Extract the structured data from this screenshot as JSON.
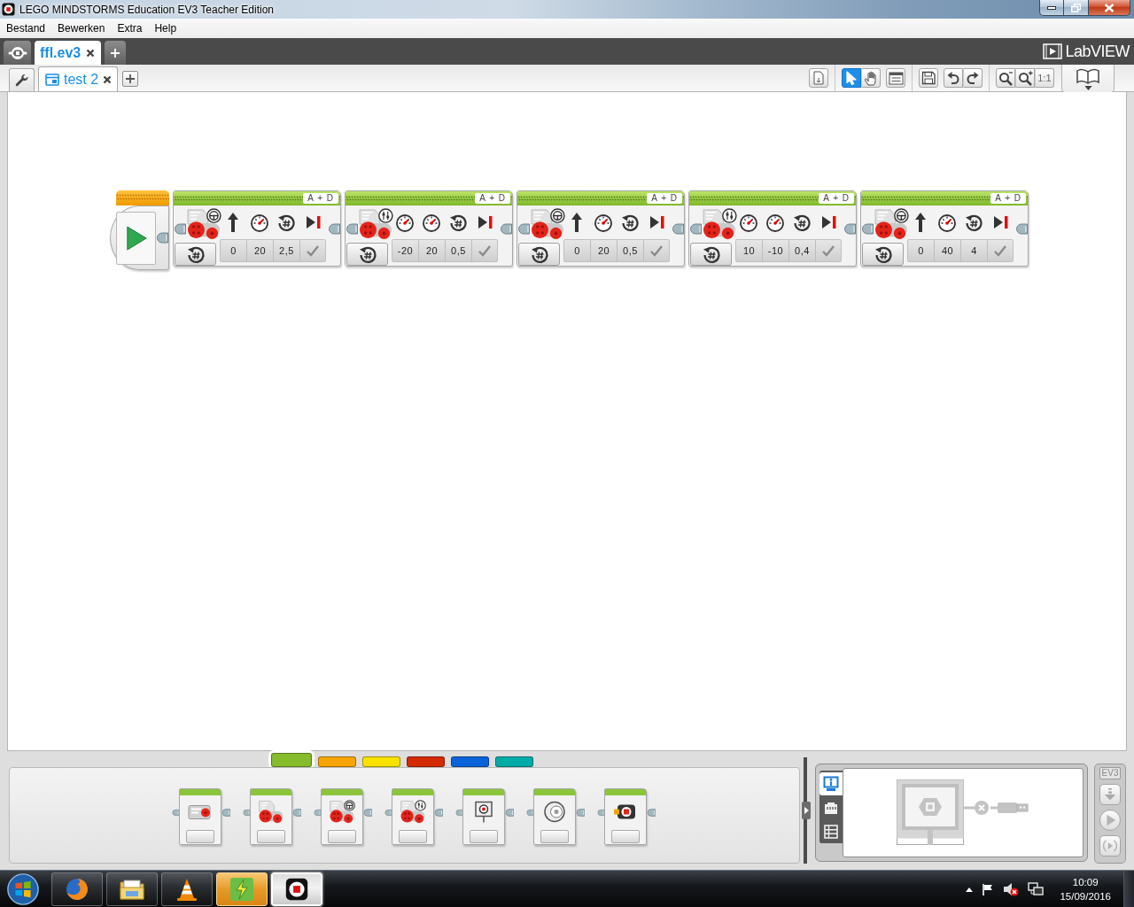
{
  "window": {
    "title": "LEGO MINDSTORMS Education EV3 Teacher Edition"
  },
  "menu": [
    {
      "label": "Bestand"
    },
    {
      "label": "Bewerken"
    },
    {
      "label": "Extra"
    },
    {
      "label": "Help"
    }
  ],
  "project_tabs": [
    {
      "label": "ffl.ev3",
      "selected": true
    }
  ],
  "brand": {
    "label": "LabVIEW"
  },
  "program_tabs": [
    {
      "label": "test 2",
      "selected": true
    }
  ],
  "toolbar": {
    "tools": [
      {
        "kind": "pointer",
        "selected": true
      },
      {
        "kind": "pan",
        "selected": false
      }
    ],
    "zoom_reset": "1:1"
  },
  "program": {
    "blocks": [
      {
        "kind": "start"
      },
      {
        "kind": "steering",
        "ports": "A + D",
        "brake": true,
        "inputs": [
          {
            "kind": "steering",
            "value": "0"
          },
          {
            "kind": "power",
            "value": "20"
          },
          {
            "kind": "rotations",
            "value": "2,5"
          }
        ]
      },
      {
        "kind": "tank",
        "ports": "A + D",
        "brake": true,
        "inputs": [
          {
            "kind": "power",
            "value": "-20"
          },
          {
            "kind": "power",
            "value": "20"
          },
          {
            "kind": "rotations",
            "value": "0,5"
          }
        ]
      },
      {
        "kind": "steering",
        "ports": "A + D",
        "brake": true,
        "inputs": [
          {
            "kind": "steering",
            "value": "0"
          },
          {
            "kind": "power",
            "value": "20"
          },
          {
            "kind": "rotations",
            "value": "0,5"
          }
        ]
      },
      {
        "kind": "tank",
        "ports": "A + D",
        "brake": true,
        "inputs": [
          {
            "kind": "power",
            "value": "10"
          },
          {
            "kind": "power",
            "value": "-10"
          },
          {
            "kind": "rotations",
            "value": "0,4"
          }
        ]
      },
      {
        "kind": "steering",
        "ports": "A + D",
        "brake": true,
        "inputs": [
          {
            "kind": "steering",
            "value": "0"
          },
          {
            "kind": "power",
            "value": "40"
          },
          {
            "kind": "rotations",
            "value": "4"
          }
        ]
      }
    ]
  },
  "palette": {
    "tabs": [
      {
        "color": "#86bc2c",
        "selected": true
      },
      {
        "color": "#f7a500",
        "selected": false
      },
      {
        "color": "#f8e200",
        "selected": false
      },
      {
        "color": "#d42a00",
        "selected": false
      },
      {
        "color": "#0a63d8",
        "selected": false
      },
      {
        "color": "#00aca8",
        "selected": false
      }
    ],
    "blocks": [
      {
        "kind": "medium-motor"
      },
      {
        "kind": "large-motor"
      },
      {
        "kind": "move-steering"
      },
      {
        "kind": "move-tank"
      },
      {
        "kind": "display"
      },
      {
        "kind": "sound"
      },
      {
        "kind": "brick-light"
      }
    ]
  },
  "hardware": {
    "tabs": [
      {
        "kind": "brick-info",
        "selected": true
      },
      {
        "kind": "port-view",
        "selected": false
      },
      {
        "kind": "available-bricks",
        "selected": false
      }
    ],
    "connected": false
  },
  "controller": {
    "label": "EV3"
  },
  "taskbar": {
    "apps": [
      {
        "kind": "browser",
        "selected": false,
        "attention": false
      },
      {
        "kind": "files",
        "selected": false,
        "attention": false
      },
      {
        "kind": "media",
        "selected": false,
        "attention": false
      },
      {
        "kind": "tool",
        "selected": false,
        "attention": true
      },
      {
        "kind": "ev3",
        "selected": true,
        "attention": false
      }
    ],
    "time": "10:09",
    "date": "15/09/2016"
  }
}
